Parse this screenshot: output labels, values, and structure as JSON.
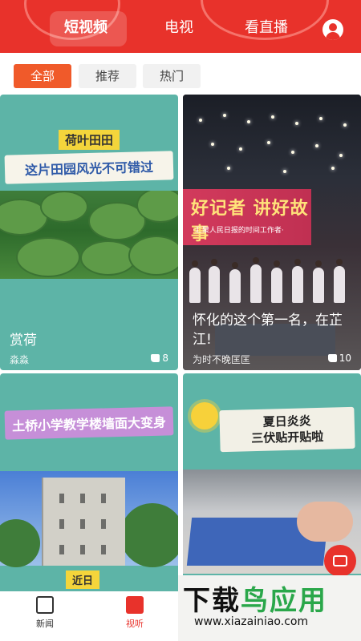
{
  "header": {
    "tabs": [
      {
        "label": "短视频",
        "active": true
      },
      {
        "label": "电视",
        "active": false
      },
      {
        "label": "看直播",
        "active": false
      }
    ],
    "accent_color": "#e8322b",
    "user_icon": "user-icon"
  },
  "filters": [
    {
      "label": "全部",
      "active": true
    },
    {
      "label": "推荐",
      "active": false
    },
    {
      "label": "热门",
      "active": false
    }
  ],
  "cards": [
    {
      "banner_tag": "荷叶田田",
      "banner_text": "这片田园风光不可错过",
      "title": "赏荷",
      "source": "淼淼",
      "likes": "8"
    },
    {
      "screen_big": "好记者 讲好故事",
      "screen_small": "·汇聚人民日报的时间工作者·",
      "title": "怀化的这个第一名，在芷江!",
      "source": "为时不晚匡匡",
      "likes": "10"
    },
    {
      "banner_text": "土桥小学教学楼墙面大变身",
      "caption_tag": "近日"
    },
    {
      "banner_text_line1": "夏日炎炎",
      "banner_text_line2": "三伏贴开贴啦",
      "fab_icon": "video-icon"
    }
  ],
  "bottom_nav": [
    {
      "label": "新闻",
      "icon": "news-icon",
      "active": false
    },
    {
      "label": "视听",
      "icon": "audio-video-icon",
      "active": true
    }
  ],
  "watermark": {
    "logo_part1": "下载",
    "logo_part2": "鸟应用",
    "url": "www.xiazainiao.com"
  }
}
